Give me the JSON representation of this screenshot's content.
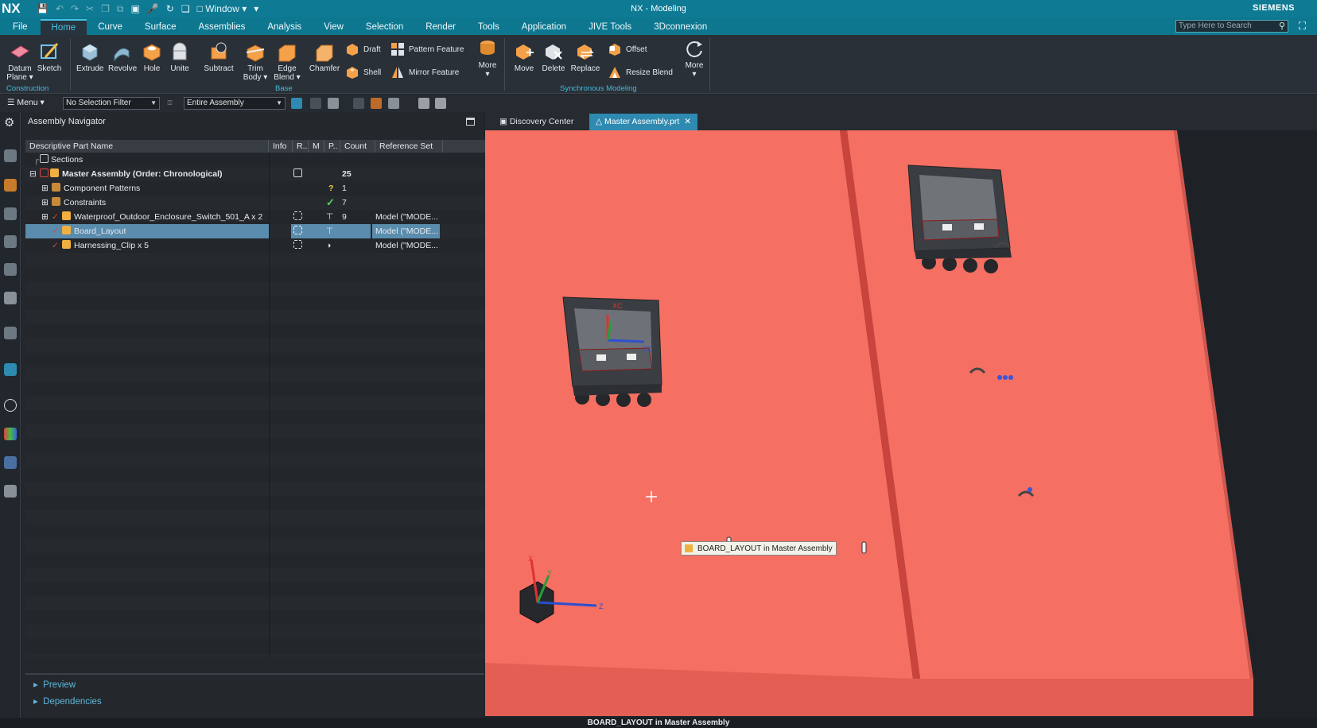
{
  "titlebar": {
    "logo": "NX",
    "window_menu": "Window",
    "title": "NX - Modeling",
    "brand": "SIEMENS"
  },
  "menubar": {
    "tabs": [
      "File",
      "Home",
      "Curve",
      "Surface",
      "Assemblies",
      "Analysis",
      "View",
      "Selection",
      "Render",
      "Tools",
      "Application",
      "JIVE Tools",
      "3Dconnexion"
    ],
    "active_tab": "Home",
    "search_placeholder": "Type Here to Search"
  },
  "ribbon": {
    "construction": {
      "label": "Construction",
      "datum_plane": "Datum Plane",
      "sketch": "Sketch"
    },
    "base": {
      "label": "Base",
      "extrude": "Extrude",
      "revolve": "Revolve",
      "hole": "Hole",
      "unite": "Unite",
      "subtract": "Subtract",
      "trim_body": "Trim Body",
      "edge_blend": "Edge Blend",
      "chamfer": "Chamfer",
      "draft": "Draft",
      "shell": "Shell",
      "pattern_feature": "Pattern Feature",
      "mirror_feature": "Mirror Feature",
      "more": "More"
    },
    "sync": {
      "label": "Synchronous Modeling",
      "move": "Move",
      "delete": "Delete",
      "replace": "Replace",
      "offset": "Offset",
      "resize_blend": "Resize Blend",
      "more": "More"
    }
  },
  "toolbar": {
    "menu": "Menu",
    "selection_filter": "No Selection Filter",
    "scope": "Entire Assembly"
  },
  "navigator": {
    "title": "Assembly Navigator",
    "columns": [
      "Descriptive Part Name",
      "Info",
      "R..",
      "M",
      "P..",
      "Count",
      "Reference Set"
    ],
    "rows": [
      {
        "name": "Sections",
        "count": "",
        "ref": ""
      },
      {
        "name": "Master Assembly (Order: Chronological)",
        "count": "25",
        "ref": ""
      },
      {
        "name": "Component Patterns",
        "count": "1",
        "ref": ""
      },
      {
        "name": "Constraints",
        "count": "7",
        "ref": ""
      },
      {
        "name": "Waterproof_Outdoor_Enclosure_Switch_501_A x 2",
        "count": "9",
        "ref": "Model (\"MODE..."
      },
      {
        "name": "Board_Layout",
        "count": "",
        "ref": "Model (\"MODE..."
      },
      {
        "name": "Harnessing_Clip x 5",
        "count": "",
        "ref": "Model (\"MODE..."
      }
    ],
    "preview": "Preview",
    "dependencies": "Dependencies"
  },
  "viewport": {
    "tabs": [
      "Discovery Center",
      "Master Assembly.prt"
    ],
    "active_tab": "Master Assembly.prt",
    "tooltip": "BOARD_LAYOUT in Master Assembly",
    "axis_labels": {
      "x": "X",
      "y": "Y",
      "z": "Z",
      "xc": "XC",
      "zc": "ZC"
    },
    "colors": {
      "board": "#f56f63",
      "board_dark": "#c8443c"
    }
  },
  "status": {
    "text": "BOARD_LAYOUT in Master Assembly"
  }
}
